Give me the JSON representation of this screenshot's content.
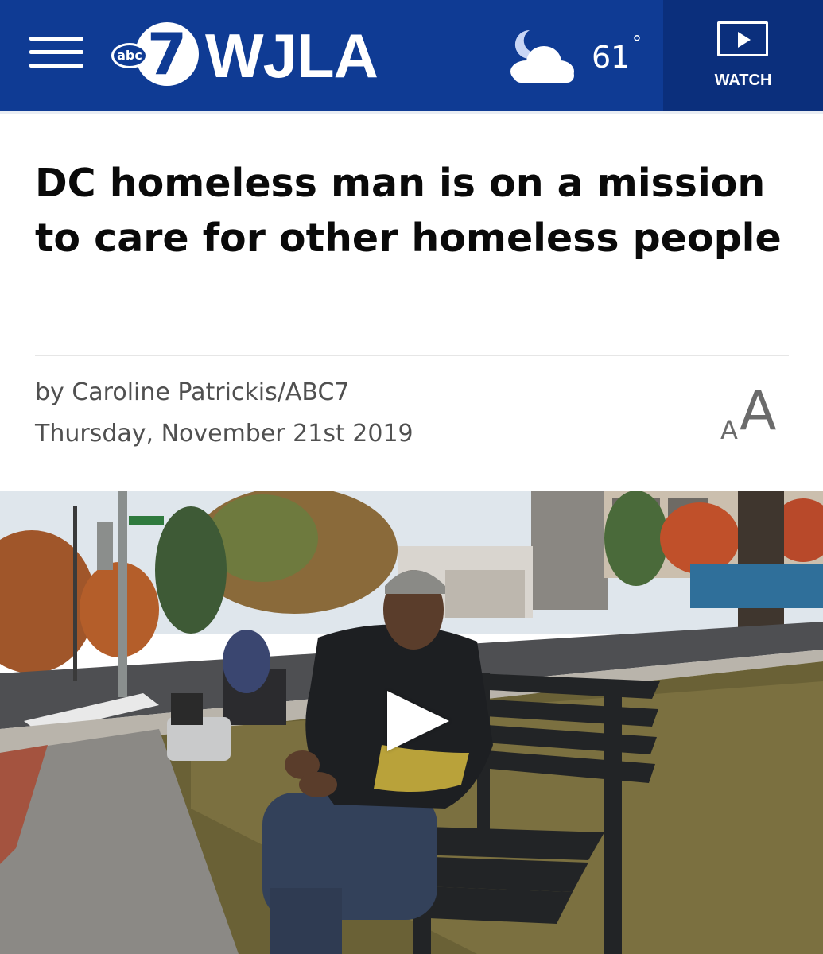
{
  "header": {
    "menu_icon": "hamburger-menu-icon",
    "logo": {
      "badge": "abc",
      "numeral": "7",
      "station": "WJLA"
    },
    "weather": {
      "icon": "partly-cloudy-night-icon",
      "temperature": "61",
      "unit": "°"
    },
    "watch": {
      "icon": "play-icon",
      "label": "WATCH"
    },
    "colors": {
      "bar": "#0f3b94",
      "watch_bg": "#0b2f7c"
    }
  },
  "article": {
    "headline": "DC homeless man is on a mission to care for other homeless people",
    "byline": "by Caroline Patrickis/ABC7",
    "date": "Thursday, November 21st 2019",
    "text_size_control": {
      "small": "A",
      "large": "A"
    },
    "video": {
      "play_icon": "play-icon",
      "description_icon": "video-thumbnail"
    }
  }
}
